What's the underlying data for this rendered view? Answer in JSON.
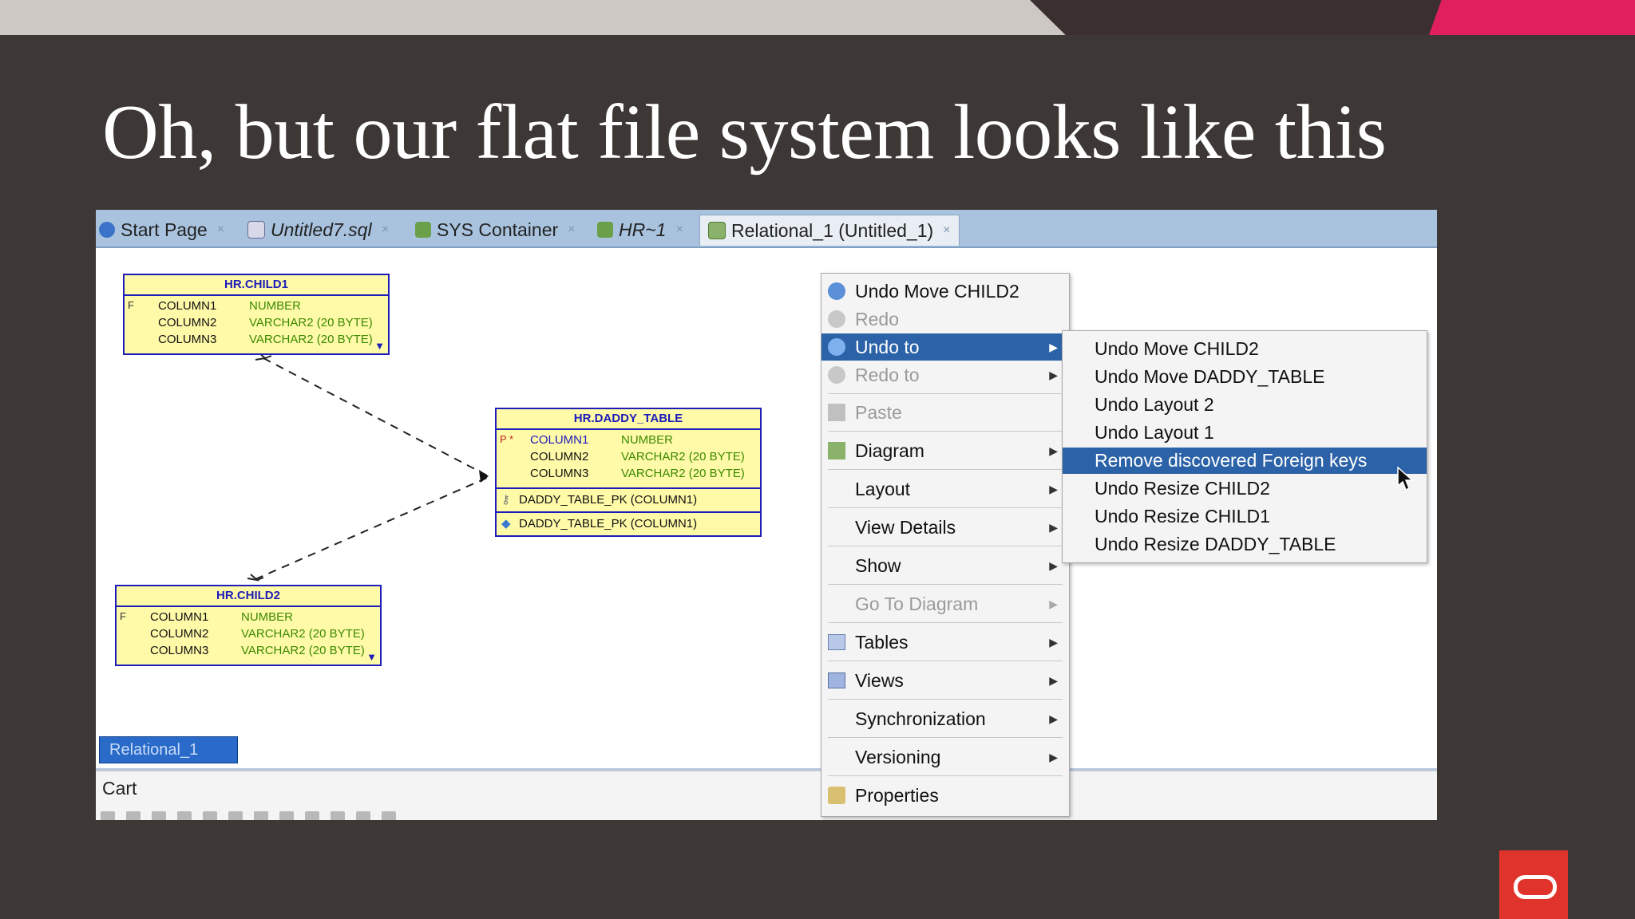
{
  "slide": {
    "title": "Oh, but our flat file system looks like this"
  },
  "tabs": [
    {
      "label": "Start Page",
      "close": "×"
    },
    {
      "label": "Untitled7.sql",
      "close": "×"
    },
    {
      "label": "SYS Container",
      "close": "×"
    },
    {
      "label": "HR~1",
      "close": "×"
    },
    {
      "label": "Relational_1 (Untitled_1)",
      "close": "×"
    }
  ],
  "tables": {
    "child1": {
      "title": "HR.CHILD1",
      "rows": [
        {
          "flag": "F",
          "name": "COLUMN1",
          "type": "NUMBER"
        },
        {
          "flag": "",
          "name": "COLUMN2",
          "type": "VARCHAR2 (20 BYTE)"
        },
        {
          "flag": "",
          "name": "COLUMN3",
          "type": "VARCHAR2 (20 BYTE)"
        }
      ]
    },
    "daddy": {
      "title": "HR.DADDY_TABLE",
      "rows": [
        {
          "flag": "P *",
          "name": "COLUMN1",
          "type": "NUMBER"
        },
        {
          "flag": "",
          "name": "COLUMN2",
          "type": "VARCHAR2 (20 BYTE)"
        },
        {
          "flag": "",
          "name": "COLUMN3",
          "type": "VARCHAR2 (20 BYTE)"
        }
      ],
      "keys": [
        "DADDY_TABLE_PK (COLUMN1)",
        "DADDY_TABLE_PK (COLUMN1)"
      ]
    },
    "child2": {
      "title": "HR.CHILD2",
      "rows": [
        {
          "flag": "F",
          "name": "COLUMN1",
          "type": "NUMBER"
        },
        {
          "flag": "",
          "name": "COLUMN2",
          "type": "VARCHAR2 (20 BYTE)"
        },
        {
          "flag": "",
          "name": "COLUMN3",
          "type": "VARCHAR2 (20 BYTE)"
        }
      ]
    }
  },
  "diagram_tab": "Relational_1",
  "cart_label": "Cart",
  "context_menu": [
    {
      "label": "Undo Move CHILD2",
      "state": "normal",
      "submenu": false
    },
    {
      "label": "Redo",
      "state": "disabled",
      "submenu": false
    },
    {
      "label": "Undo to",
      "state": "selected",
      "submenu": true
    },
    {
      "label": "Redo to",
      "state": "disabled",
      "submenu": true
    },
    {
      "label": "Paste",
      "state": "disabled",
      "submenu": false
    },
    {
      "label": "Diagram",
      "state": "normal",
      "submenu": true
    },
    {
      "label": "Layout",
      "state": "normal",
      "submenu": true
    },
    {
      "label": "View Details",
      "state": "normal",
      "submenu": true
    },
    {
      "label": "Show",
      "state": "normal",
      "submenu": true
    },
    {
      "label": "Go To Diagram",
      "state": "disabled",
      "submenu": true
    },
    {
      "label": "Tables",
      "state": "normal",
      "submenu": true
    },
    {
      "label": "Views",
      "state": "normal",
      "submenu": true
    },
    {
      "label": "Synchronization",
      "state": "normal",
      "submenu": true
    },
    {
      "label": "Versioning",
      "state": "normal",
      "submenu": true
    },
    {
      "label": "Properties",
      "state": "normal",
      "submenu": false
    }
  ],
  "undo_submenu": [
    {
      "label": "Undo Move CHILD2",
      "selected": false
    },
    {
      "label": "Undo Move DADDY_TABLE",
      "selected": false
    },
    {
      "label": "Undo Layout 2",
      "selected": false
    },
    {
      "label": "Undo Layout 1",
      "selected": false
    },
    {
      "label": "Remove discovered Foreign keys",
      "selected": true
    },
    {
      "label": "Undo Resize CHILD2",
      "selected": false
    },
    {
      "label": "Undo Resize CHILD1",
      "selected": false
    },
    {
      "label": "Undo Resize DADDY_TABLE",
      "selected": false
    }
  ],
  "arrow_glyph": "▶",
  "colors": {
    "slide_bg": "#3d3735",
    "menu_highlight": "#2c63a8",
    "table_fill": "#fffaa8",
    "table_border": "#1c1cb8",
    "accent_pink": "#e0205c",
    "oracle_red": "#e0332b"
  }
}
